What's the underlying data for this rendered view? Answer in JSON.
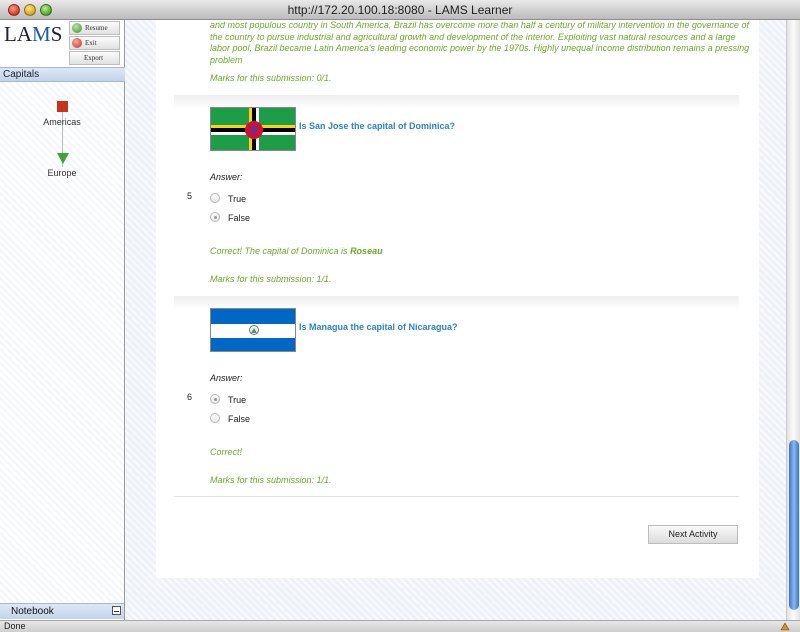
{
  "window": {
    "title": "http://172.20.100.18:8080 - LAMS Learner"
  },
  "sidebar": {
    "logo_text_left": "LA",
    "logo_text_m": "M",
    "logo_text_right": "S",
    "controls": {
      "resume": "Resume",
      "exit": "Exit",
      "export": "Export"
    },
    "sequence_title": "Capitals",
    "activities": [
      {
        "label": "Americas",
        "status": "current"
      },
      {
        "label": "Europe",
        "status": "pending"
      }
    ],
    "notebook_label": "Notebook"
  },
  "main": {
    "previous_feedback": "and most populous country in South America, Brazil has overcome more than half a century of military intervention in the governance of the country to pursue industrial and agricultural growth and development of the interior. Exploiting vast natural resources and a large labor pool, Brazil became Latin America's leading economic power by the 1970s. Highly unequal income distribution remains a pressing problem",
    "previous_marks": "Marks for this submission: 0/1.",
    "questions": [
      {
        "number": "5",
        "text": "Is San Jose the capital of Dominica?",
        "answer_label": "Answer:",
        "options": [
          {
            "label": "True",
            "selected": false
          },
          {
            "label": "False",
            "selected": true
          }
        ],
        "feedback_prefix": "Correct! The capital of Dominica is ",
        "feedback_bold": "Roseau",
        "marks": "Marks for this submission: 1/1."
      },
      {
        "number": "6",
        "text": "Is Managua the capital of Nicaragua?",
        "answer_label": "Answer:",
        "options": [
          {
            "label": "True",
            "selected": true
          },
          {
            "label": "False",
            "selected": false
          }
        ],
        "feedback_prefix": "Correct!",
        "marks": "Marks for this submission: 1/1."
      }
    ],
    "next_button": "Next Activity"
  },
  "statusbar": {
    "text": "Done"
  },
  "colors": {
    "feedback_green": "#6aaa2a",
    "question_blue": "#2e84c4",
    "current_activity": "#c8321c",
    "pending_activity": "#3fa33a"
  }
}
